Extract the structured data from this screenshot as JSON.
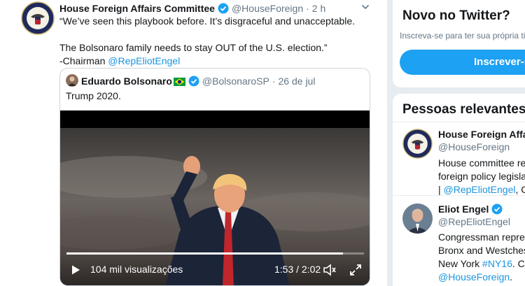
{
  "tweet": {
    "author_name": "House Foreign Affairs Committee",
    "author_handle": "@HouseForeign",
    "separator": "·",
    "time": "2 h",
    "text_line1": "“We’ve seen this playbook before. It’s disgraceful and unacceptable.",
    "text_line2": "The Bolsonaro family needs to stay OUT of the U.S. election.”",
    "text_line3_prefix": "-Chairman ",
    "text_line3_mention": "@RepEliotEngel"
  },
  "quoted_tweet": {
    "author_name": "Eduardo Bolsonaro",
    "author_handle": "@BolsonaroSP",
    "separator": "·",
    "date": "26 de jul",
    "text": "Trump 2020.",
    "video": {
      "views": "104 mil visualizações",
      "time": "1:53 / 2:02",
      "progress": 0.93
    }
  },
  "sidebar": {
    "signup": {
      "title": "Novo no Twitter?",
      "subtitle": "Inscreva-se para ter sua própria timeline",
      "button": "Inscrever-se"
    },
    "relevant": {
      "title": "Pessoas relevantes",
      "people": [
        {
          "name": "House Foreign Affa…",
          "handle": "@HouseForeign",
          "bio_line1": "House committee resp",
          "bio_line2": "foreign policy legislat",
          "bio_line3_prefix": "| ",
          "bio_line3_mention": "@RepEliotEngel",
          "bio_line3_suffix": ", Cha"
        },
        {
          "name": "Eliot Engel",
          "handle": "@RepEliotEngel",
          "bio_line1": "Congressman represe",
          "bio_line2": "Bronx and Westcheste",
          "bio_line3_prefix": "New York ",
          "bio_line3_mention": "#NY16",
          "bio_line3_suffix": ". Cha",
          "bio_line4_mention": "@HouseForeign",
          "bio_line4_suffix": "."
        }
      ]
    }
  },
  "colors": {
    "accent": "#1da1f2",
    "link": "#1b95e0",
    "secondary_text": "#657786",
    "border": "#ccd6dd"
  }
}
